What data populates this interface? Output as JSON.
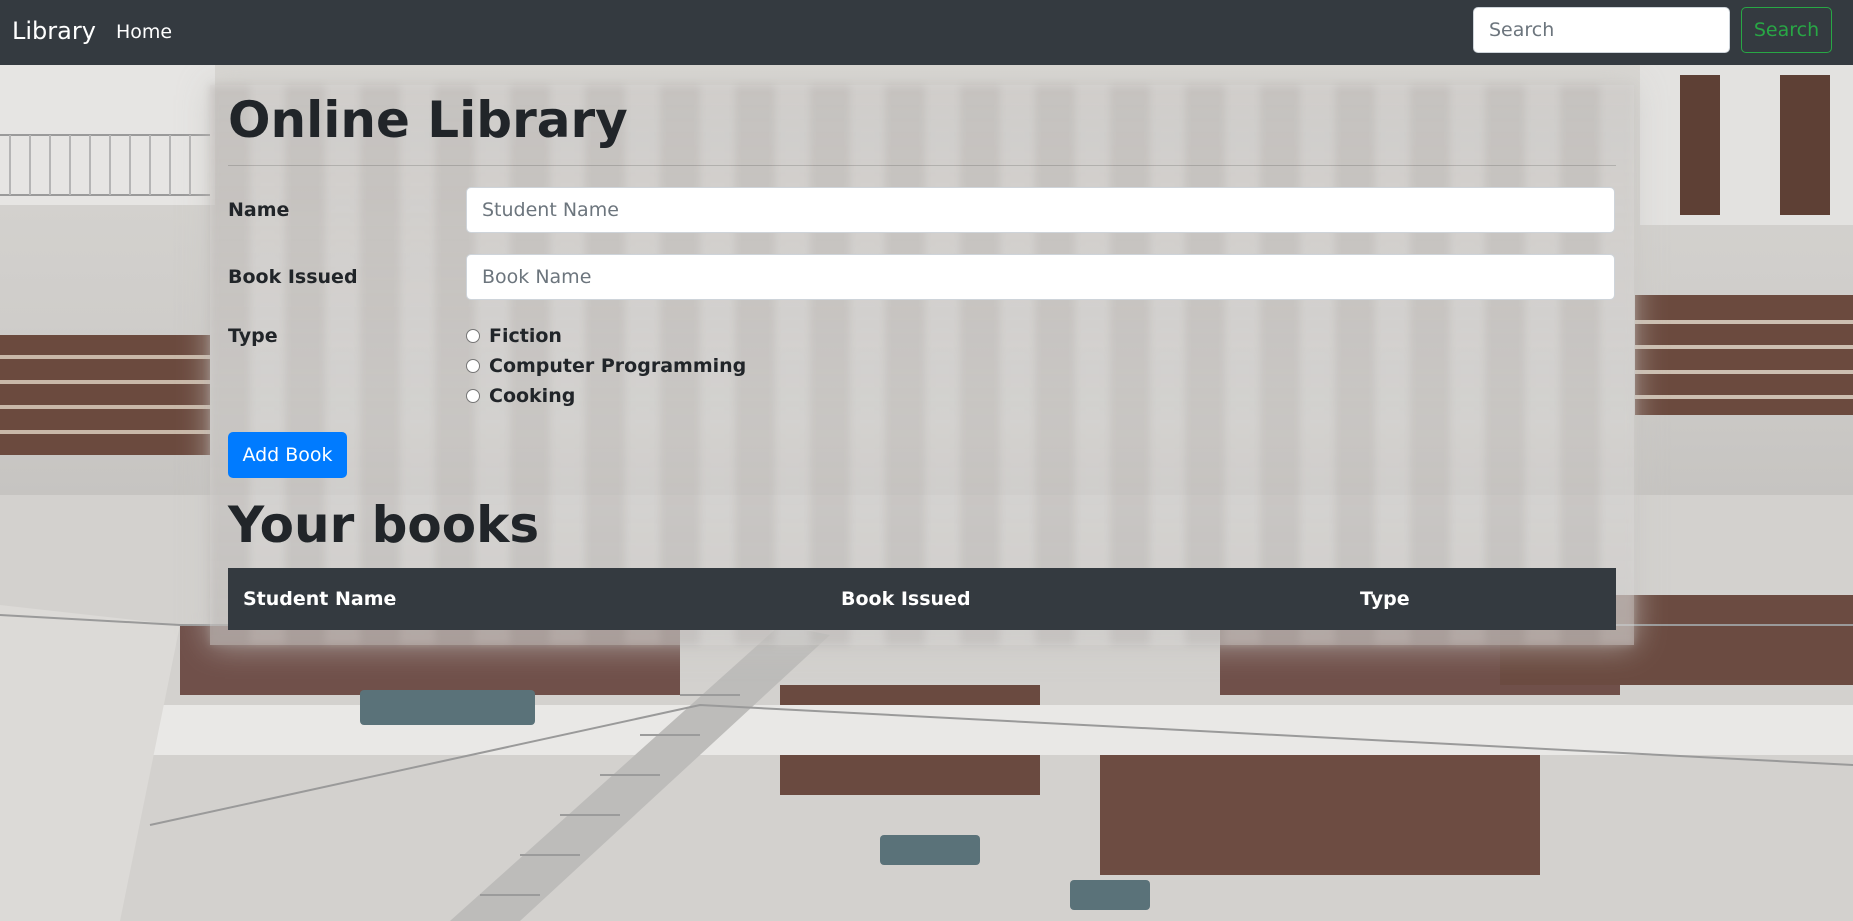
{
  "navbar": {
    "brand": "Library",
    "home_link": "Home",
    "search_placeholder": "Search",
    "search_button": "Search"
  },
  "form": {
    "title": "Online Library",
    "name_label": "Name",
    "name_placeholder": "Student Name",
    "book_label": "Book Issued",
    "book_placeholder": "Book Name",
    "type_label": "Type",
    "types": [
      {
        "label": "Fiction",
        "checked": false
      },
      {
        "label": "Computer Programming",
        "checked": false
      },
      {
        "label": "Cooking",
        "checked": false
      }
    ],
    "submit_button": "Add Book"
  },
  "books": {
    "title": "Your books",
    "columns": [
      "Student Name",
      "Book Issued",
      "Type"
    ],
    "rows": []
  },
  "colors": {
    "navbar_bg": "#343a40",
    "primary": "#007bff",
    "success": "#28a745",
    "text_dark": "#212529"
  }
}
